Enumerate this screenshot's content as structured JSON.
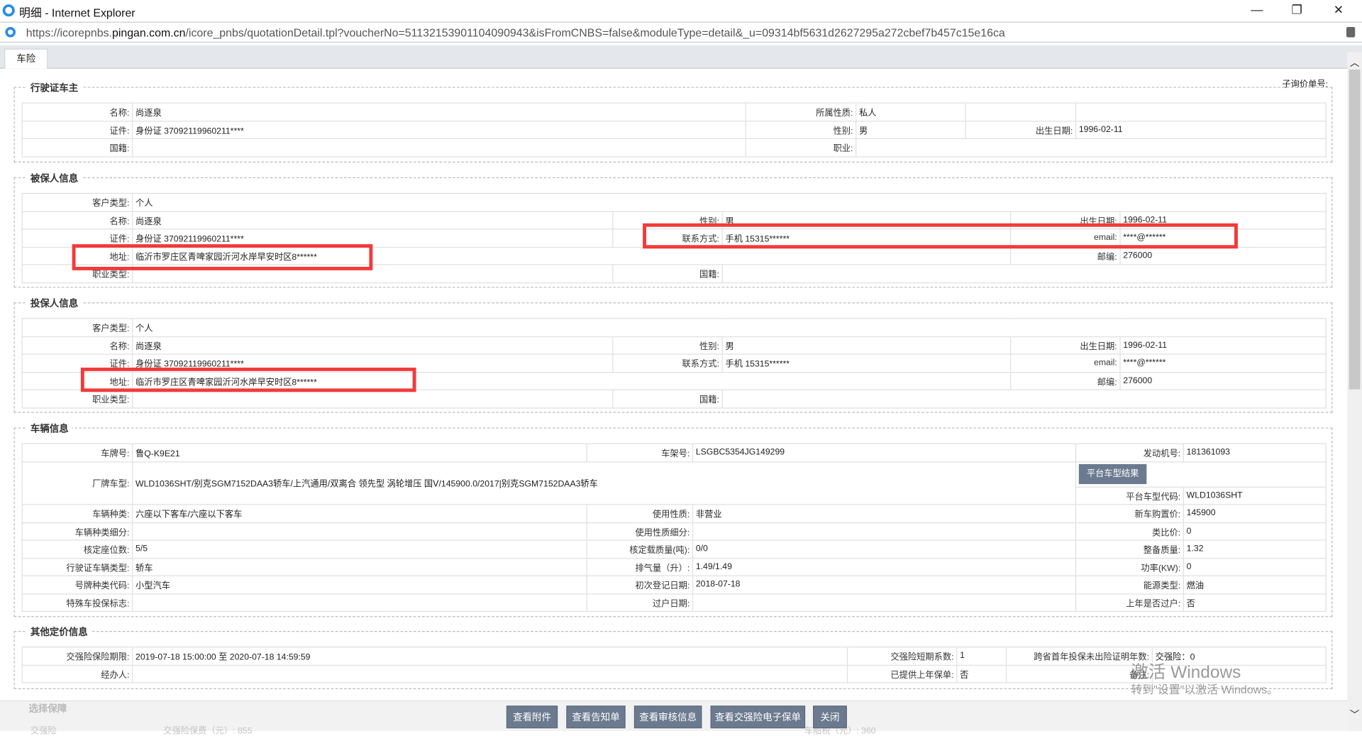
{
  "window": {
    "title": "明细 - Internet Explorer",
    "minimize": "—",
    "restore": "❐",
    "close": "✕"
  },
  "address": {
    "prefix": "https://icorepnbs.",
    "domain": "pingan.com.cn",
    "path": "/icore_pnbs/quotationDetail.tpl?voucherNo=51132153901104090943&isFromCNBS=false&moduleType=detail&_u=09314bf5631d2627295a272cbef7b457c15e16ca"
  },
  "tab": "车险",
  "sub_quote_label": "子询价单号:",
  "owner": {
    "title": "行驶证车主",
    "name_l": "名称:",
    "name": "尚逐泉",
    "nature_l": "所属性质:",
    "nature": "私人",
    "id_l": "证件:",
    "id": "身份证  37092119960211****",
    "gender_l": "性别:",
    "gender": "男",
    "birth_l": "出生日期:",
    "birth": "1996-02-11",
    "nation_l": "国籍:",
    "job_l": "职业:"
  },
  "insured": {
    "title": "被保人信息",
    "ctype_l": "客户类型:",
    "ctype": "个人",
    "name_l": "名称:",
    "name": "尚逐泉",
    "gender_l": "性别:",
    "gender": "男",
    "birth_l": "出生日期:",
    "birth": "1996-02-11",
    "id_l": "证件:",
    "id": "身份证 37092119960211****",
    "contact_l": "联系方式:",
    "contact": "手机 15315******",
    "email_l": "email:",
    "email": "****@******",
    "addr_l": "地址:",
    "addr": "临沂市罗庄区青啤家园沂河水岸早安时区8******",
    "zip_l": "邮编:",
    "zip": "276000",
    "job_l": "职业类型:",
    "nation_l": "国籍:"
  },
  "applicant": {
    "title": "投保人信息",
    "ctype_l": "客户类型:",
    "ctype": "个人",
    "name_l": "名称:",
    "name": "尚逐泉",
    "gender_l": "性别:",
    "gender": "男",
    "birth_l": "出生日期:",
    "birth": "1996-02-11",
    "id_l": "证件:",
    "id": "身份证 37092119960211****",
    "contact_l": "联系方式:",
    "contact": "手机 15315******",
    "email_l": "email:",
    "email": "****@******",
    "addr_l": "地址:",
    "addr": "临沂市罗庄区青啤家园沂河水岸早安时区8******",
    "zip_l": "邮编:",
    "zip": "276000",
    "job_l": "职业类型:",
    "nation_l": "国籍:"
  },
  "vehicle": {
    "title": "车辆信息",
    "plate_l": "车牌号:",
    "plate": "鲁Q-K9E21",
    "vin_l": "车架号:",
    "vin": "LSGBC5354JG149299",
    "engine_l": "发动机号:",
    "engine": "181361093",
    "model_l": "厂牌车型:",
    "model": "WLD1036SHT/别克SGM7152DAA3轿车/上汽通用/双离合 领先型 涡轮增压 国Ⅴ/145900.0/2017|别克SGM7152DAA3轿车",
    "platform_btn": "平台车型结果",
    "pcode_l": "平台车型代码:",
    "pcode": "WLD1036SHT",
    "kind_l": "车辆种类:",
    "kind": "六座以下客车/六座以下客车",
    "use_l": "使用性质:",
    "use": "非营业",
    "price_l": "新车购置价:",
    "price": "145900",
    "kindsub_l": "车辆种类细分:",
    "usesub_l": "使用性质细分:",
    "analog_l": "类比价:",
    "analog": "0",
    "seats_l": "核定座位数:",
    "seats": "5/5",
    "load_l": "核定载质量(吨):",
    "load": "0/0",
    "curb_l": "整备质量:",
    "curb": "1.32",
    "lictype_l": "行驶证车辆类型:",
    "lictype": "轿车",
    "disp_l": "排气量（升）:",
    "disp": "1.49/1.49",
    "power_l": "功率(KW):",
    "power": "0",
    "platetype_l": "号牌种类代码:",
    "platetype": "小型汽车",
    "regdate_l": "初次登记日期:",
    "regdate": "2018-07-18",
    "energy_l": "能源类型:",
    "energy": "燃油",
    "special_l": "特殊车投保标志:",
    "transfer_l": "过户日期:",
    "lasttransfer_l": "上年是否过户:",
    "lasttransfer": "否"
  },
  "pricing": {
    "title": "其他定价信息",
    "period_l": "交强险保险期限:",
    "period": "2019-07-18 15:00:00 至 2020-07-18 14:59:59",
    "short_l": "交强险短期系数:",
    "short": "1",
    "years_l": "跨省首年投保未出险证明年数:",
    "years": "交强险：0",
    "agent_l": "经办人:",
    "prev_l": "已提供上年保单:",
    "prev": "否",
    "remark_l": "备注:"
  },
  "coverage": {
    "title": "选择保障",
    "c1": "交强险",
    "c2": "交强险保费（元）:  855",
    "c3": "车船税（元）:  360"
  },
  "buttons": [
    "查看附件",
    "查看告知单",
    "查看审核信息",
    "查看交强险电子保单",
    "关闭"
  ],
  "watermark": {
    "line1": "激活 Windows",
    "line2": "转到\"设置\"以激活 Windows。"
  }
}
